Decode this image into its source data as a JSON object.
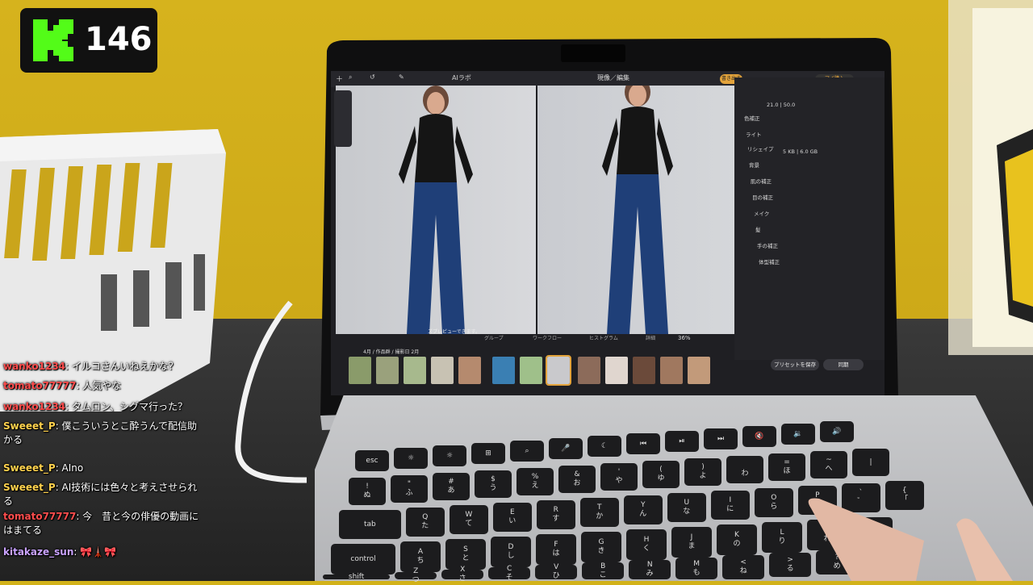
{
  "badge": {
    "count": "146"
  },
  "screen": {
    "top_title": "現像／編集",
    "ai_label": "AIラボ",
    "top_button_1": "書き出す",
    "top_button_2": "マイ購入",
    "overlay_text": "ズプレビューできます。",
    "zoom": "36%",
    "folder_path": "4月 / 作品群 / 撮影日 2月",
    "panel_items": [
      "色補正",
      "ライト",
      "リシェイプ",
      "背景",
      "肌の補正",
      "目の補正",
      "メイク",
      "髪",
      "手の補正",
      "体型補正"
    ],
    "panel_values": [
      "21.0 | 50.0",
      "5 KB | 6.0 GB"
    ],
    "toolbar_items": [
      "グループ",
      "ワークフロー",
      "ヒストグラム",
      "詳細"
    ],
    "save_preset": "プリセットを保存",
    "sync": "同期"
  },
  "keyboard": {
    "keys_row1": [
      "esc",
      "☼",
      "☼",
      "⊞",
      "⌕",
      "🎤",
      "☾",
      "⏮",
      "⏯",
      "⏭",
      "🔇",
      "🔉",
      "🔊"
    ],
    "keys_row2": [
      "!\nぬ",
      "\"\nふ",
      "#\nあ",
      "$\nう",
      "%\nえ",
      "&\nお",
      "'\nや",
      "(\nゆ",
      ")\nよ",
      "\nわ",
      "=\nほ",
      "~\nへ",
      "|"
    ],
    "keys_row3": [
      "tab",
      "Q\nた",
      "W\nて",
      "E\nい",
      "R\nす",
      "T\nか",
      "Y\nん",
      "U\nな",
      "I\nに",
      "O\nら",
      "P\nせ",
      "`\n゛",
      "{\n「"
    ],
    "keys_row4": [
      "control",
      "A\nち",
      "S\nと",
      "D\nし",
      "F\nは",
      "G\nき",
      "H\nく",
      "J\nま",
      "K\nの",
      "L\nり",
      "+\nれ",
      ":\nけ"
    ],
    "keys_row5": [
      "shift",
      "Z\nつ",
      "X\nさ",
      "C\nそ",
      "V\nひ",
      "B\nこ",
      "N\nみ",
      "M\nも",
      "<\nね",
      ">\nる",
      "?\nめ"
    ]
  },
  "chat": [
    {
      "user": "wanko1234",
      "message": "イルコさんいねえかな？",
      "color": "red"
    },
    {
      "user": "tomato77777",
      "message": "人気やな",
      "color": "red"
    },
    {
      "user": "wanko1234",
      "message": "タムロン、シグマ行った？",
      "color": "red"
    },
    {
      "user": "Sweeet_P",
      "message": "僕こういうとこ酔うんで配信助かる",
      "color": "yellow"
    },
    {
      "user": "Sweeet_P",
      "message": "AIno",
      "color": "yellow"
    },
    {
      "user": "Sweeet_P",
      "message": "AI技術には色々と考えさせられる",
      "color": "yellow"
    },
    {
      "user": "tomato77777",
      "message": "今　昔と今の俳優の動画にはまてる",
      "color": "red"
    },
    {
      "user": "kitakaze_sun",
      "message": "🎀🗼🎀",
      "color": "purple"
    }
  ]
}
